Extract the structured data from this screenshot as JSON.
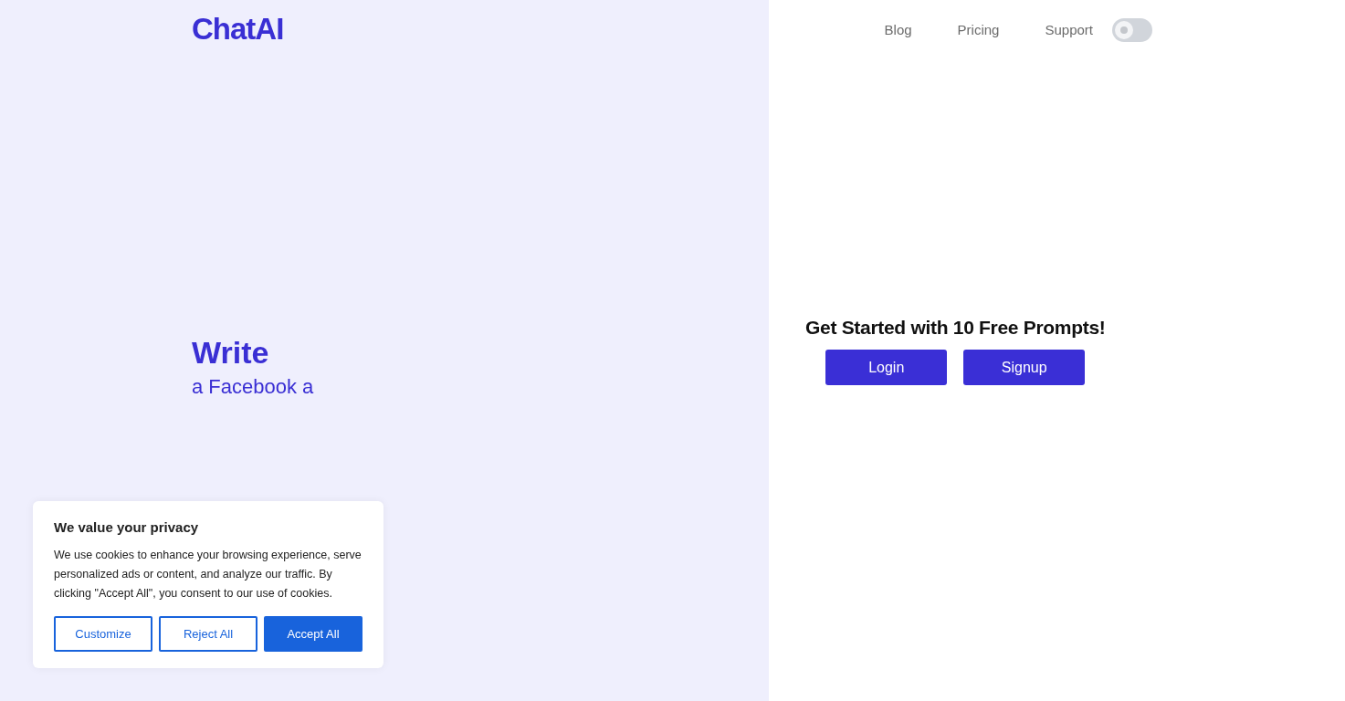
{
  "header": {
    "logo": "ChatAI",
    "nav": [
      {
        "label": "Blog"
      },
      {
        "label": "Pricing"
      },
      {
        "label": "Support"
      }
    ],
    "theme_toggle": {
      "on": false
    }
  },
  "hero": {
    "heading": "Write",
    "typed_text": "a Facebook a"
  },
  "cta": {
    "title": "Get Started with 10 Free Prompts!",
    "buttons": [
      {
        "label": "Login"
      },
      {
        "label": "Signup"
      }
    ]
  },
  "cookie_banner": {
    "title": "We value your privacy",
    "text": "We use cookies to enhance your browsing experience, serve personalized ads or content, and analyze our traffic. By clicking \"Accept All\", you consent to our use of cookies.",
    "buttons": [
      {
        "label": "Customize",
        "kind": "outline"
      },
      {
        "label": "Reject All",
        "kind": "outline"
      },
      {
        "label": "Accept All",
        "kind": "primary"
      }
    ]
  }
}
